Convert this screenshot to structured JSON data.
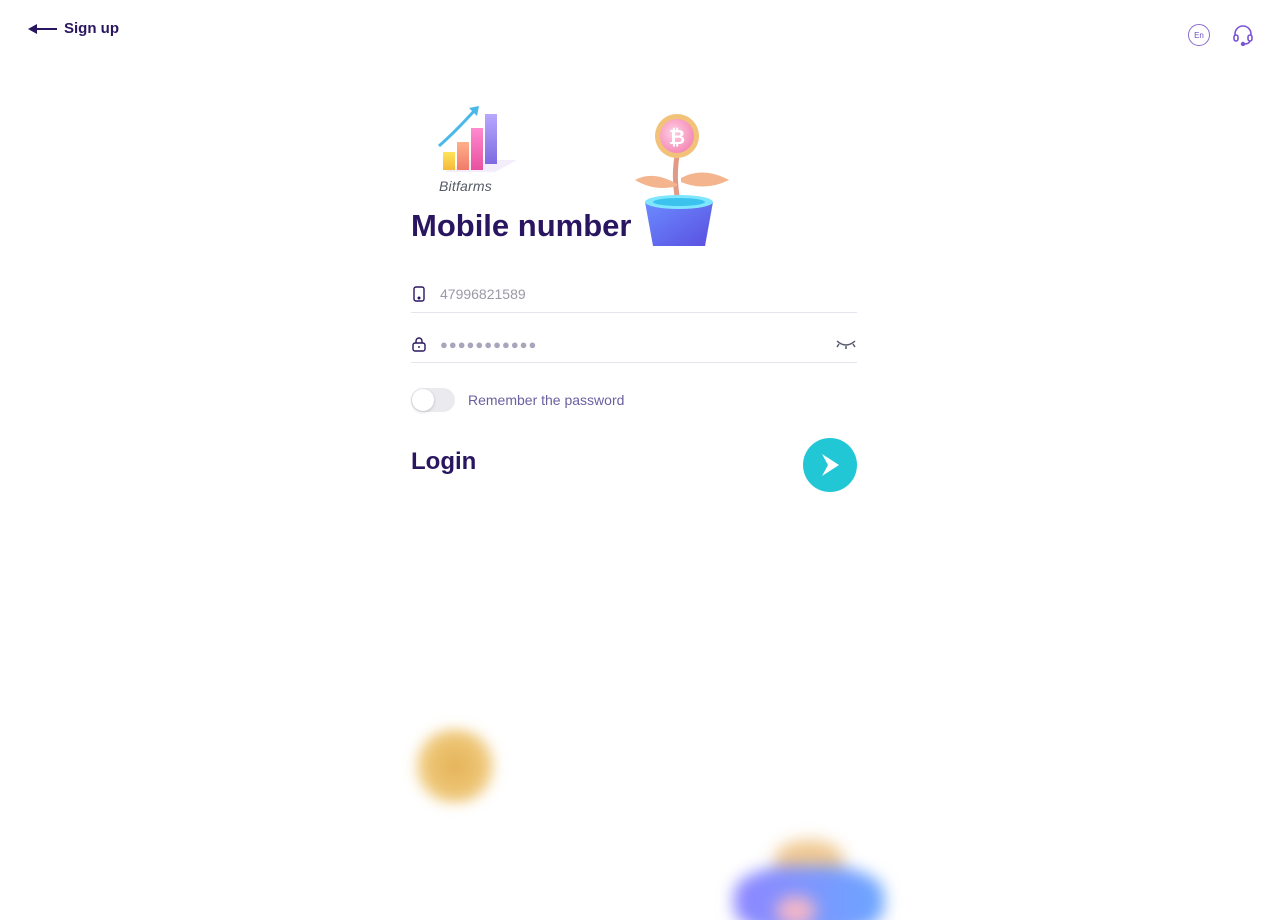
{
  "header": {
    "back_label": "Sign up",
    "language_label": "En"
  },
  "branding": {
    "logo_text": "Bitfarms"
  },
  "form": {
    "title": "Mobile number",
    "phone_value": "47996821589",
    "password_mask": "●●●●●●●●●●●",
    "remember_label": "Remember the password",
    "remember_checked": false,
    "submit_label": "Login"
  },
  "icons": {
    "back": "arrow-left-icon",
    "language": "language-icon",
    "support": "headset-icon",
    "phone": "phone-icon",
    "lock": "lock-icon",
    "eye": "eye-closed-icon",
    "submit": "chevron-right-icon"
  },
  "colors": {
    "primary_text": "#2a1660",
    "accent": "#22c7d6",
    "icon": "#6d4fc0"
  }
}
